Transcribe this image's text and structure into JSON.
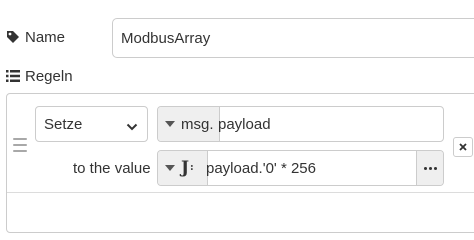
{
  "name_field": {
    "label": "Name",
    "value": "ModbusArray",
    "icon": "tag-icon"
  },
  "rules": {
    "label": "Regeln",
    "icon": "list-icon",
    "items": [
      {
        "action": "Setze",
        "target_type": "msg.",
        "target_value": "payload",
        "to_value_label": "to the value",
        "value_type_icon": "jsonata-icon",
        "value": "payload.'0' * 256"
      }
    ]
  },
  "colors": {
    "border": "#cccccc",
    "button_bg": "#efefef",
    "text": "#333333"
  }
}
